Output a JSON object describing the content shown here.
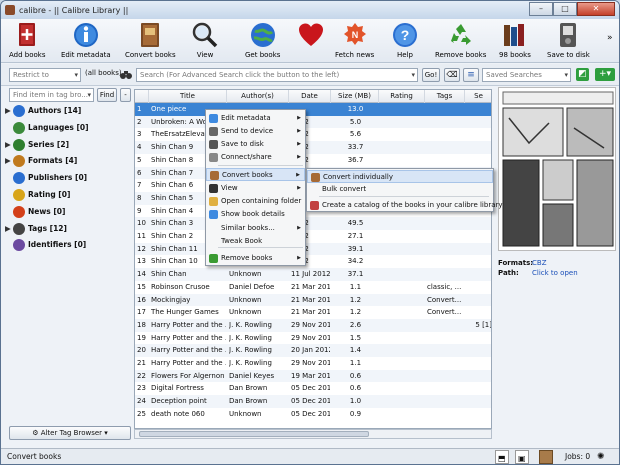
{
  "window": {
    "title": "calibre - || Calibre Library ||",
    "min": "–",
    "max": "□",
    "close": "✕"
  },
  "toolbar": [
    {
      "label": "Add books",
      "icon": "add-books-icon"
    },
    {
      "label": "Edit metadata",
      "icon": "edit-metadata-icon"
    },
    {
      "label": "Convert books",
      "icon": "convert-books-icon"
    },
    {
      "label": "View",
      "icon": "view-icon"
    },
    {
      "label": "Get books",
      "icon": "get-books-icon"
    },
    {
      "label": "Donate",
      "icon": "heart-icon"
    },
    {
      "label": "Fetch news",
      "icon": "fetch-news-icon"
    },
    {
      "label": "Help",
      "icon": "help-icon"
    },
    {
      "label": "Remove books",
      "icon": "recycle-icon"
    },
    {
      "label": "98 books",
      "icon": "library-icon"
    },
    {
      "label": "Save to disk",
      "icon": "save-disk-icon"
    }
  ],
  "toolbar_more": "»",
  "search": {
    "restrict_placeholder": "Restrict to",
    "all_books": "(all books)",
    "placeholder": "Search (For Advanced Search click the button to the left)",
    "go": "Go!",
    "saved_placeholder": "Saved Searches"
  },
  "tagbrowser": {
    "find_placeholder": "Find item in tag bro...",
    "find_button": "Find",
    "collapse": "-",
    "items": [
      {
        "label": "Authors [14]",
        "arrow": "▶"
      },
      {
        "label": "Languages [0]",
        "arrow": ""
      },
      {
        "label": "Series [2]",
        "arrow": "▶"
      },
      {
        "label": "Formats [4]",
        "arrow": "▶"
      },
      {
        "label": "Publishers [0]",
        "arrow": ""
      },
      {
        "label": "Rating [0]",
        "arrow": ""
      },
      {
        "label": "News [0]",
        "arrow": ""
      },
      {
        "label": "Tags [12]",
        "arrow": "▶"
      },
      {
        "label": "Identifiers [0]",
        "arrow": ""
      }
    ],
    "alter_button": "Alter Tag Browser"
  },
  "table": {
    "columns": [
      "",
      "Title",
      "Author(s)",
      "Date",
      "Size (MB)",
      "Rating",
      "Tags",
      "Se"
    ],
    "rows": [
      [
        "1",
        "One piece",
        "",
        "…",
        "13.0",
        "",
        "",
        ""
      ],
      [
        "2",
        "Unbroken: A Worl",
        "",
        "2012",
        "5.0",
        "",
        "",
        ""
      ],
      [
        "3",
        "TheErsatzElevator",
        "",
        "2012",
        "5.6",
        "",
        "",
        ""
      ],
      [
        "4",
        "Shin Chan 9",
        "",
        "2012",
        "33.7",
        "",
        "",
        ""
      ],
      [
        "5",
        "Shin Chan 8",
        "",
        "2012",
        "36.7",
        "",
        "",
        ""
      ],
      [
        "6",
        "Shin Chan 7",
        "",
        "",
        "",
        "",
        "",
        ""
      ],
      [
        "7",
        "Shin Chan 6",
        "",
        "",
        "",
        "",
        "",
        ""
      ],
      [
        "8",
        "Shin Chan 5",
        "",
        "",
        "",
        "",
        "",
        ""
      ],
      [
        "9",
        "Shin Chan 4",
        "",
        "",
        "",
        "",
        "",
        ""
      ],
      [
        "10",
        "Shin Chan 3",
        "",
        "2012",
        "49.5",
        "",
        "",
        ""
      ],
      [
        "11",
        "Shin Chan 2",
        "",
        "2012",
        "27.1",
        "",
        "",
        ""
      ],
      [
        "12",
        "Shin Chan 11",
        "",
        "2012",
        "39.1",
        "",
        "",
        ""
      ],
      [
        "13",
        "Shin Chan 10",
        "",
        "2012",
        "34.2",
        "",
        "",
        ""
      ],
      [
        "14",
        "Shin Chan",
        "Unknown",
        "11 Jul 2012",
        "37.1",
        "",
        "",
        ""
      ],
      [
        "15",
        "Robinson Crusoe",
        "Daniel Defoe",
        "21 Mar 2012",
        "1.1",
        "",
        "classic, ...",
        ""
      ],
      [
        "16",
        "Mockingjay",
        "Unknown",
        "21 Mar 2012",
        "1.2",
        "",
        "Convert...",
        ""
      ],
      [
        "17",
        "The Hunger Games",
        "Unknown",
        "21 Mar 2012",
        "1.2",
        "",
        "Convert...",
        ""
      ],
      [
        "18",
        "Harry Potter and the ...",
        "J. K. Rowling",
        "29 Nov 2011",
        "2.6",
        "",
        "",
        "5 [1]"
      ],
      [
        "19",
        "Harry Potter and the ...",
        "J. K. Rowling",
        "29 Nov 2011",
        "1.5",
        "",
        "",
        ""
      ],
      [
        "20",
        "Harry Potter and the ...",
        "J. K. Rowling",
        "20 Jan 2012",
        "1.4",
        "",
        "",
        ""
      ],
      [
        "21",
        "Harry Potter and the ...",
        "J. K. Rowling",
        "29 Nov 2011",
        "1.1",
        "",
        "",
        ""
      ],
      [
        "22",
        "Flowers For Algernon",
        "Daniel Keyes",
        "19 Mar 2012",
        "0.6",
        "",
        "",
        ""
      ],
      [
        "23",
        "Digital Fortress",
        "Dan Brown",
        "05 Dec 2011",
        "0.6",
        "",
        "",
        ""
      ],
      [
        "24",
        "Deception point",
        "Dan Brown",
        "05 Dec 2011",
        "1.0",
        "",
        "",
        ""
      ],
      [
        "25",
        "death note 060",
        "Unknown",
        "05 Dec 2011",
        "0.9",
        "",
        "",
        ""
      ]
    ]
  },
  "context_menu": [
    {
      "label": "Edit metadata",
      "icon": "edit-icon",
      "sub": true
    },
    {
      "label": "Send to device",
      "icon": "device-icon",
      "sub": true
    },
    {
      "label": "Save to disk",
      "icon": "disk-icon",
      "sub": true
    },
    {
      "label": "Connect/share",
      "icon": "share-icon",
      "sub": true
    },
    {
      "label": "Convert books",
      "icon": "convert-icon",
      "sub": true,
      "highlight": true
    },
    {
      "label": "View",
      "icon": "view-icon",
      "sub": true
    },
    {
      "label": "Open containing folder",
      "icon": "folder-icon",
      "sub": false
    },
    {
      "label": "Show book details",
      "icon": "details-icon",
      "sub": false
    },
    {
      "label": "Similar books...",
      "icon": "",
      "sub": true
    },
    {
      "label": "Tweak Book",
      "icon": "",
      "sub": false
    },
    {
      "label": "Remove books",
      "icon": "recycle-icon",
      "sub": true
    }
  ],
  "submenu": [
    {
      "label": "Convert individually",
      "highlight": true
    },
    {
      "label": "Bulk convert",
      "highlight": false
    },
    {
      "label": "Create a catalog of the books in your calibre library",
      "highlight": false
    }
  ],
  "details": {
    "formats_label": "Formats:",
    "formats_value": "CBZ",
    "path_label": "Path:",
    "path_value": "Click to open"
  },
  "status": {
    "text": "Convert books",
    "jobs": "Jobs: 0"
  }
}
